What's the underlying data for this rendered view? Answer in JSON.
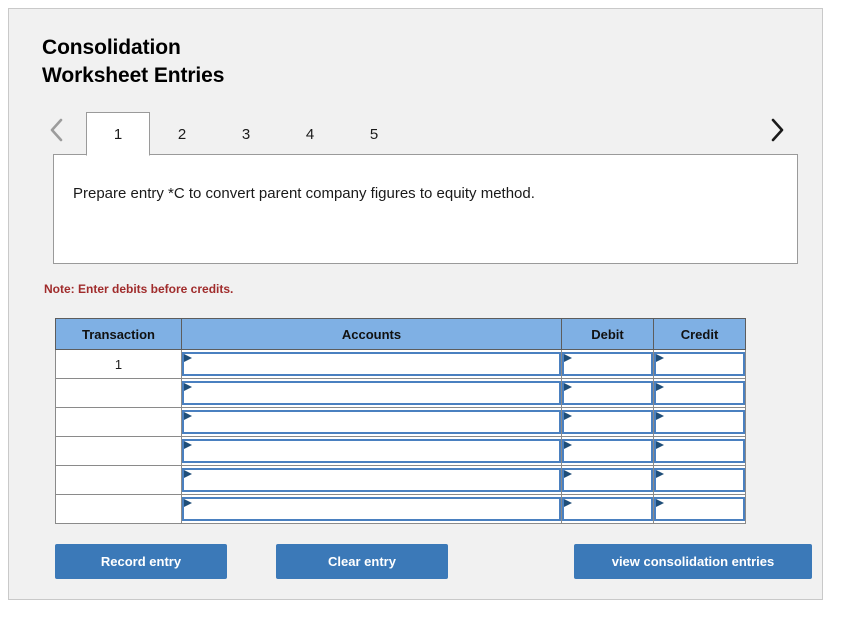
{
  "header": {
    "title": "Consolidation\nWorksheet Entries"
  },
  "tabs": {
    "prev_icon": "chevron-left-icon",
    "next_icon": "chevron-right-icon",
    "items": [
      {
        "label": "1",
        "active": true
      },
      {
        "label": "2",
        "active": false
      },
      {
        "label": "3",
        "active": false
      },
      {
        "label": "4",
        "active": false
      },
      {
        "label": "5",
        "active": false
      }
    ]
  },
  "question": {
    "text": "Prepare entry *C to convert parent company figures to equity method."
  },
  "note": {
    "text": "Note: Enter debits before credits."
  },
  "table": {
    "headers": {
      "transaction": "Transaction",
      "accounts": "Accounts",
      "debit": "Debit",
      "credit": "Credit"
    },
    "rows": [
      {
        "transaction": "1",
        "accounts": "",
        "debit": "",
        "credit": ""
      },
      {
        "transaction": "",
        "accounts": "",
        "debit": "",
        "credit": ""
      },
      {
        "transaction": "",
        "accounts": "",
        "debit": "",
        "credit": ""
      },
      {
        "transaction": "",
        "accounts": "",
        "debit": "",
        "credit": ""
      },
      {
        "transaction": "",
        "accounts": "",
        "debit": "",
        "credit": ""
      },
      {
        "transaction": "",
        "accounts": "",
        "debit": "",
        "credit": ""
      }
    ]
  },
  "buttons": {
    "record": "Record entry",
    "clear": "Clear entry",
    "view": "view consolidation entries"
  },
  "colors": {
    "card_background": "#f1f1f1",
    "header_blue": "#7fb0e4",
    "button_blue": "#3b79b8",
    "note_red": "#a02c2c",
    "input_border_blue": "#4a80c0",
    "panel_border_gray": "#9a9a9a"
  }
}
